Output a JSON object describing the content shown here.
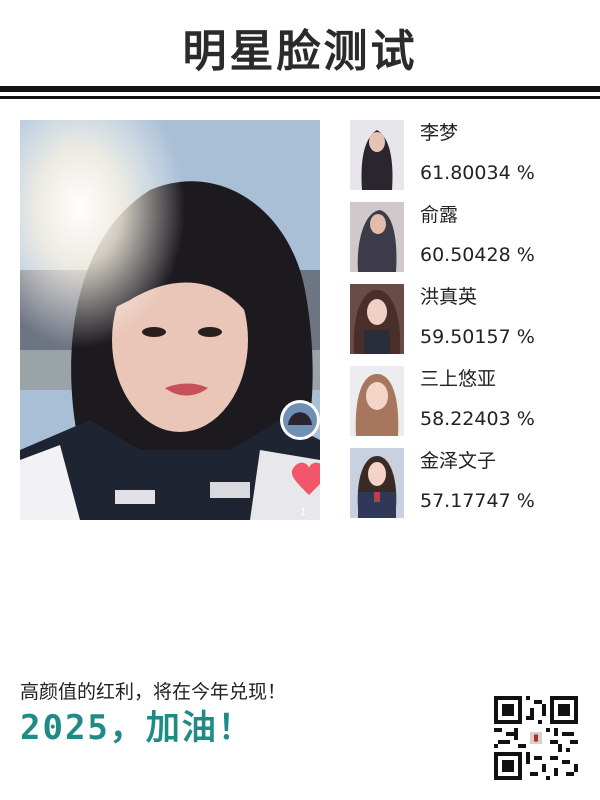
{
  "title": "明星脸测试",
  "matches": [
    {
      "name": "李梦",
      "score": "61.80034 %",
      "thumb_color": "#2b2530"
    },
    {
      "name": "俞露",
      "score": "60.50428 %",
      "thumb_color": "#3d3a4a"
    },
    {
      "name": "洪真英",
      "score": "59.50157 %",
      "thumb_color": "#4a2e2a"
    },
    {
      "name": "三上悠亚",
      "score": "58.22403 %",
      "thumb_color": "#c9b4a3"
    },
    {
      "name": "金泽文子",
      "score": "57.17747 %",
      "thumb_color": "#30385a"
    }
  ],
  "photo": {
    "badge_number": "1"
  },
  "footer": {
    "slogan": "高颜值的红利，将在今年兑现！",
    "year_text": "2025，加油！"
  },
  "colors": {
    "accent": "#1e8b87",
    "rule": "#111111",
    "heart": "#f2566a"
  }
}
